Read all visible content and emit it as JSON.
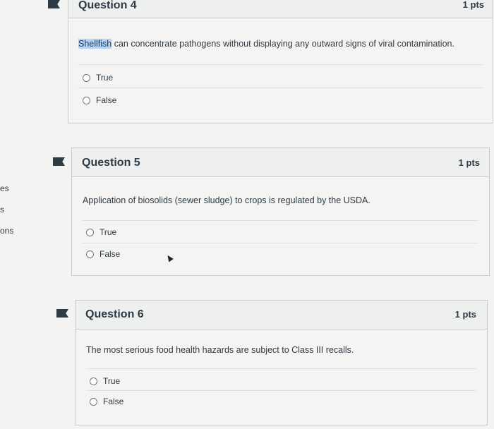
{
  "sidebar_fragments": [
    "es",
    "s",
    "ons"
  ],
  "questions": [
    {
      "title": "Question 4",
      "points": "1 pts",
      "text_highlight": "Shellfish",
      "text_rest": " can concentrate pathogens without displaying any outward signs of viral contamination.",
      "answers": [
        "True",
        "False"
      ]
    },
    {
      "title": "Question 5",
      "points": "1 pts",
      "text": "Application of biosolids (sewer sludge) to crops is regulated by the USDA.",
      "answers": [
        "True",
        "False"
      ]
    },
    {
      "title": "Question 6",
      "points": "1 pts",
      "text": "The most serious food health hazards are subject to Class III recalls.",
      "answers": [
        "True",
        "False"
      ]
    }
  ]
}
